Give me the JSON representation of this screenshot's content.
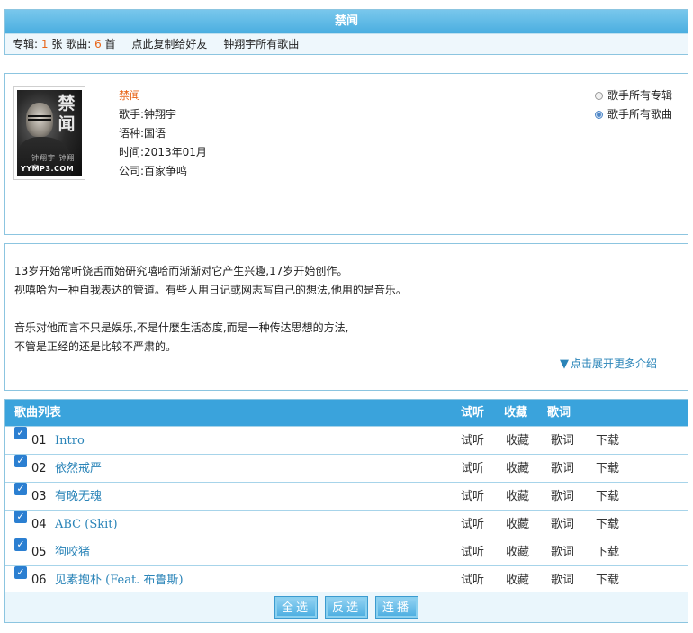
{
  "header": {
    "title": "禁闻",
    "stats": {
      "album_label": "专辑:",
      "album_count": "1",
      "album_unit": "张",
      "song_label": "歌曲:",
      "song_count": "6",
      "song_unit": "首"
    },
    "copy_link": "点此复制给好友",
    "all_songs_link": "钟翔宇所有歌曲"
  },
  "album": {
    "cover": {
      "title_chars": "禁闻",
      "subtitle": "钟翔宇 钟翔宇",
      "watermark": "YYMP3.COM"
    },
    "name": "禁闻",
    "singer_label": "歌手:",
    "singer": "钟翔宇",
    "language_label": "语种:",
    "language": "国语",
    "date_label": "时间:",
    "date": "2013年01月",
    "company_label": "公司:",
    "company": "百家争鸣"
  },
  "filters": [
    {
      "label": "歌手所有专辑",
      "selected": false
    },
    {
      "label": "歌手所有歌曲",
      "selected": true
    }
  ],
  "intro": {
    "lines": [
      "13岁开始常听饶舌而始研究嘻哈而渐渐对它产生兴趣,17岁开始创作。",
      "视嘻哈为一种自我表达的管道。有些人用日记或网志写自己的想法,他用的是音乐。",
      "",
      "音乐对他而言不只是娱乐,不是什麽生活态度,而是一种传达思想的方法,",
      "不管是正经的还是比较不严肃的。"
    ],
    "expand_icon": "▼",
    "expand_label": "点击展开更多介绍"
  },
  "song_list": {
    "header": {
      "title": "歌曲列表",
      "listen": "试听",
      "favorite": "收藏",
      "lyrics": "歌词"
    },
    "songs": [
      {
        "no": "01",
        "title": "Intro",
        "listen": "试听",
        "favorite": "收藏",
        "lyrics": "歌词",
        "download": "下载",
        "checked": true
      },
      {
        "no": "02",
        "title": "依然戒严",
        "listen": "试听",
        "favorite": "收藏",
        "lyrics": "歌词",
        "download": "下载",
        "checked": true
      },
      {
        "no": "03",
        "title": "有晚无魂",
        "listen": "试听",
        "favorite": "收藏",
        "lyrics": "歌词",
        "download": "下载",
        "checked": true
      },
      {
        "no": "04",
        "title": "ABC (Skit)",
        "listen": "试听",
        "favorite": "收藏",
        "lyrics": "歌词",
        "download": "下载",
        "checked": true
      },
      {
        "no": "05",
        "title": "狗咬猪",
        "listen": "试听",
        "favorite": "收藏",
        "lyrics": "歌词",
        "download": "下载",
        "checked": true
      },
      {
        "no": "06",
        "title": "见素抱朴 (Feat. 布鲁斯)",
        "listen": "试听",
        "favorite": "收藏",
        "lyrics": "歌词",
        "download": "下载",
        "checked": true
      }
    ],
    "buttons": {
      "select_all": "全选",
      "invert": "反选",
      "play_continuous": "连播"
    }
  },
  "colors": {
    "accent_blue": "#3aa3dc",
    "link_blue": "#2a84b8",
    "count_orange": "#e8661a",
    "border_blue": "#8cc5e0"
  }
}
